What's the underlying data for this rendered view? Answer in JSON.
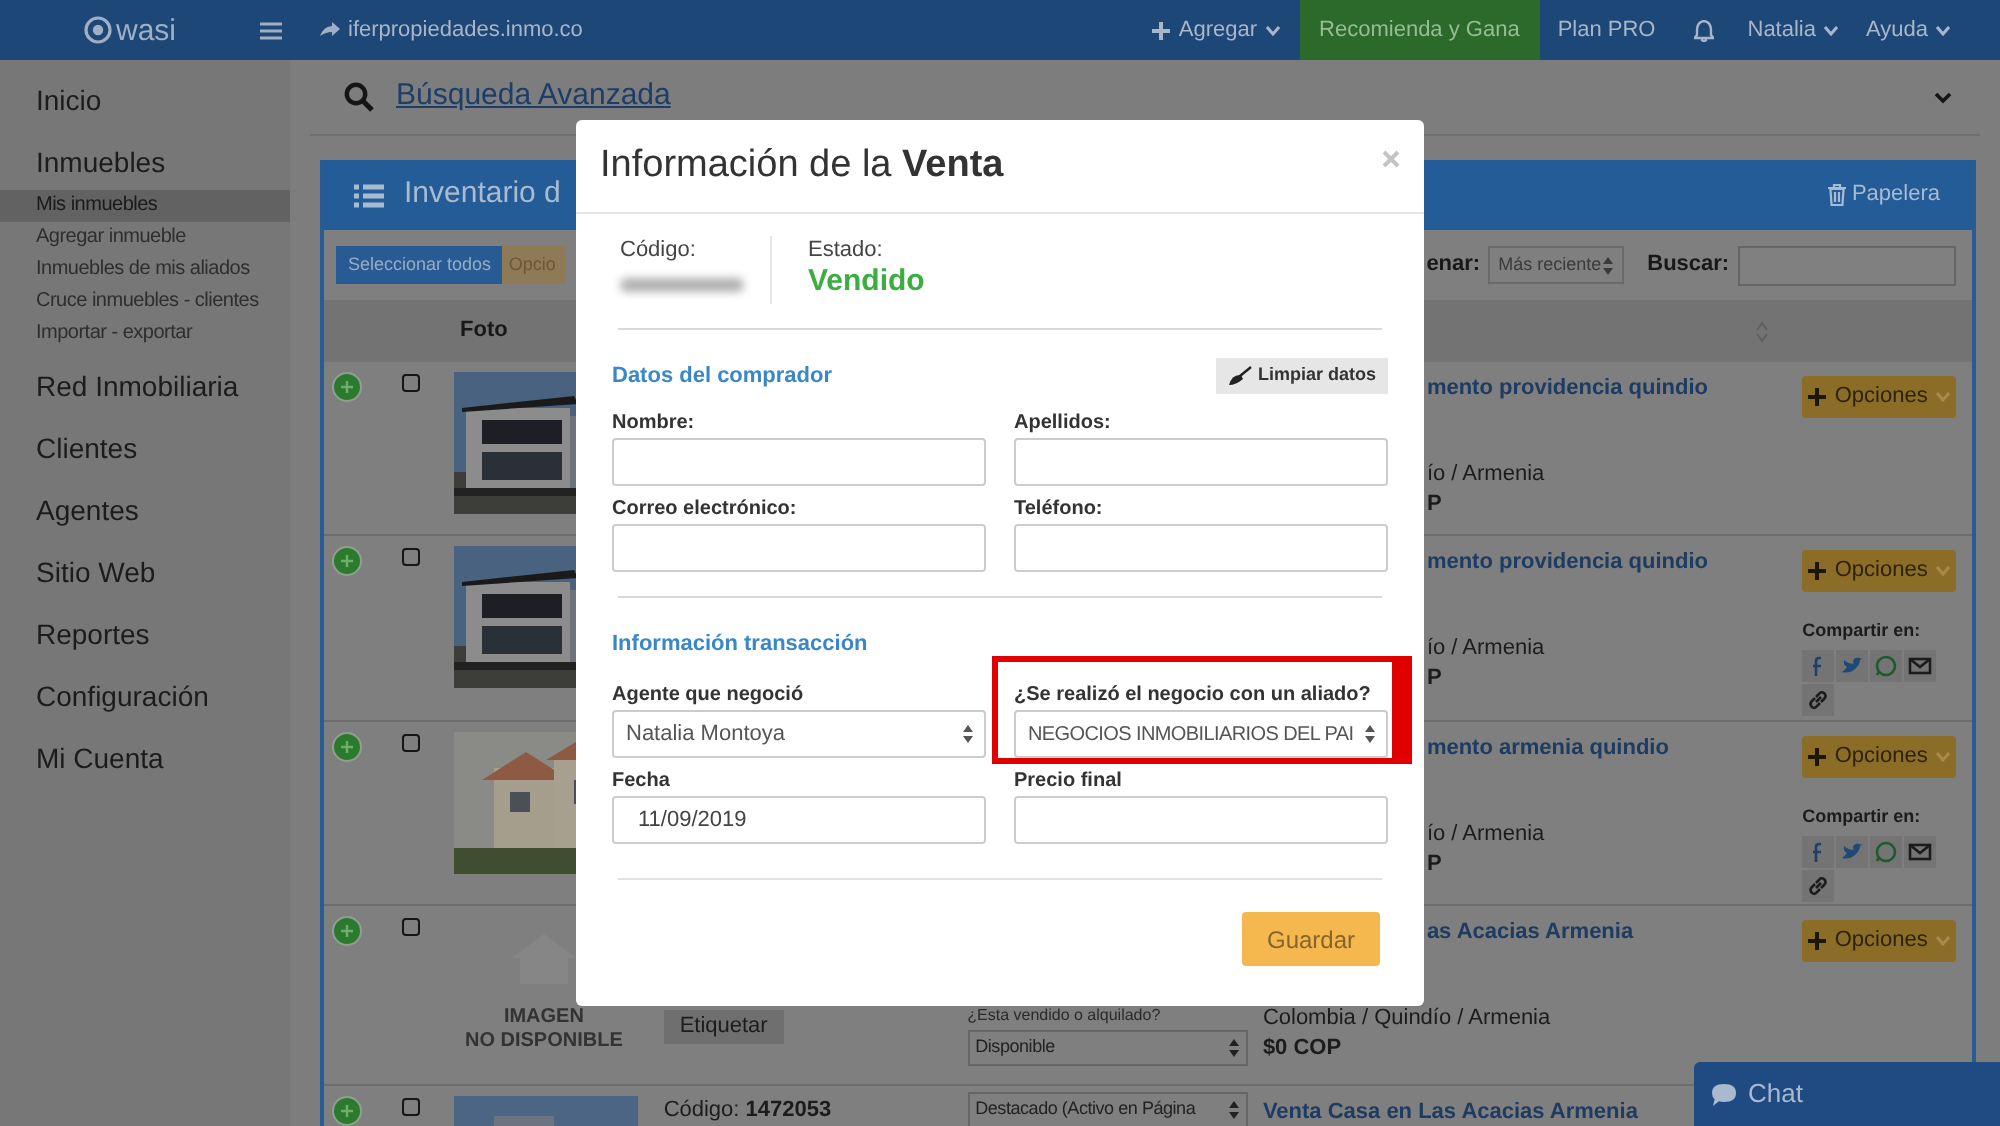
{
  "topbar": {
    "logo": "wasi",
    "site": "iferpropiedades.inmo.co",
    "items": [
      {
        "kind": "add",
        "label": "Agregar"
      },
      {
        "kind": "promo",
        "label": "Recomienda y Gana"
      },
      {
        "kind": "link",
        "label": "Plan PRO"
      },
      {
        "kind": "bell"
      },
      {
        "kind": "menu",
        "label": "Natalia"
      },
      {
        "kind": "menu",
        "label": "Ayuda"
      }
    ]
  },
  "sidebar": {
    "items": [
      {
        "label": "Inicio"
      },
      {
        "label": "Inmuebles",
        "children": [
          {
            "label": "Mis inmuebles",
            "selected": true
          },
          {
            "label": "Agregar inmueble",
            "selected": false
          },
          {
            "label": "Inmuebles de mis aliados",
            "selected": false
          },
          {
            "label": "Cruce inmuebles - clientes",
            "selected": false
          },
          {
            "label": "Importar - exportar",
            "selected": false
          }
        ]
      },
      {
        "label": "Red Inmobiliaria"
      },
      {
        "label": "Clientes"
      },
      {
        "label": "Agentes"
      },
      {
        "label": "Sitio Web"
      },
      {
        "label": "Reportes"
      },
      {
        "label": "Configuración"
      },
      {
        "label": "Mi Cuenta"
      }
    ]
  },
  "search": {
    "link": "Búsqueda Avanzada"
  },
  "inventory": {
    "title": "Inventario d",
    "trash": "Papelera",
    "select_all": "Seleccionar todos",
    "options_button": "Opcio",
    "sort_label": "enar:",
    "sort_value": "Más reciente",
    "search_label": "Buscar:",
    "columns": [
      "Foto"
    ],
    "rows": [
      {
        "checked": false,
        "title": "mento providencia quindio",
        "location": "ío / Armenia",
        "price": "P",
        "options": "Opciones"
      },
      {
        "checked": false,
        "title": "mento providencia quindio",
        "location": "ío / Armenia",
        "price": "P",
        "options": "Opciones",
        "share": "Compartir en:"
      },
      {
        "checked": false,
        "title": "mento armenia quindio",
        "location": "ío / Armenia",
        "price": "P",
        "options": "Opciones",
        "share": "Compartir en:"
      },
      {
        "no_image": [
          "IMAGEN",
          "NO DISPONIBLE"
        ],
        "checked": false,
        "tag_button": "Etiquetar",
        "status_label": "¿Esta vendido o alquilado?",
        "status_value": "Disponible",
        "title": "as Acacias Armenia",
        "location": "Colombia / Quindío / Armenia",
        "price": "$0 COP",
        "options": "Opciones"
      },
      {
        "checked": false,
        "code": "Código: **1472053**",
        "status_value": "Destacado (Activo en Página",
        "title": "Venta Casa en Las Acacias Armenia"
      }
    ]
  },
  "modal": {
    "title": "Información de la **Venta**",
    "code_label": "Código:",
    "code_redacted": true,
    "state_label": "Estado:",
    "state": "Vendido",
    "sections": [
      {
        "title": "Datos del comprador",
        "action": "Limpiar datos",
        "fields": [
          {
            "kind": "input",
            "label": "Nombre:",
            "highlighted": false
          },
          {
            "kind": "input",
            "label": "Apellidos:",
            "highlighted": false
          },
          {
            "kind": "input",
            "label": "Correo electrónico:",
            "highlighted": false
          },
          {
            "kind": "input",
            "label": "Teléfono:",
            "highlighted": false
          }
        ]
      },
      {
        "title": "Información transacción",
        "fields": [
          {
            "kind": "select",
            "label": "Agente que negoció",
            "value": "Natalia Montoya",
            "highlighted": false
          },
          {
            "kind": "select",
            "label": "¿Se realizó el negocio con un aliado?",
            "value": "NEGOCIOS INMOBILIARIOS DEL PAI",
            "highlighted": true
          },
          {
            "kind": "input",
            "label": "Fecha",
            "value": "11/09/2019",
            "highlighted": false
          },
          {
            "kind": "input",
            "label": "Precio final",
            "highlighted": false
          }
        ]
      }
    ],
    "submit": "Guardar"
  },
  "chat": "Chat"
}
